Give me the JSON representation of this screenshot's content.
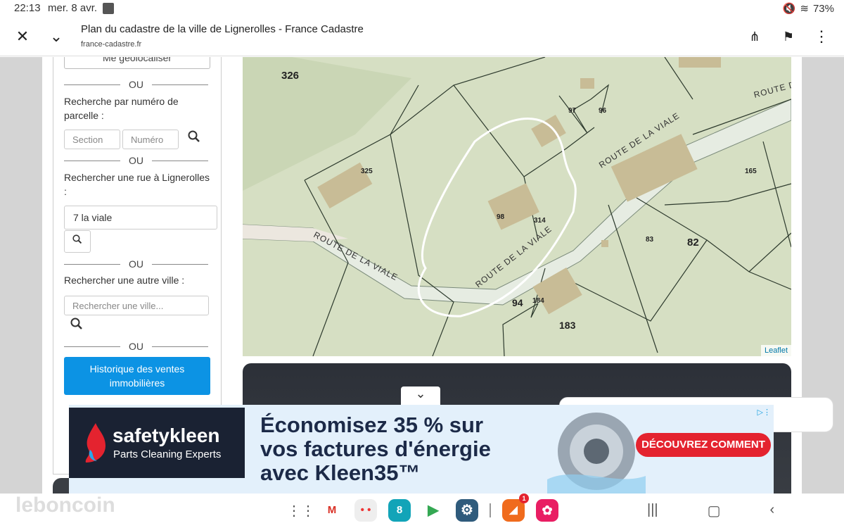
{
  "status": {
    "time": "22:13",
    "date": "mer. 8 avr.",
    "battery": "73%"
  },
  "toolbar": {
    "close_icon": "close-icon",
    "title": "Plan du cadastre de la ville de Lignerolles - France Cadastre",
    "url": "france-cadastre.fr"
  },
  "sidebar": {
    "geolocate_label": "Me géolocaliser",
    "or_label": "OU",
    "parcel_label": "Recherche par numéro de parcelle :",
    "section_placeholder": "Section",
    "number_placeholder": "Numéro",
    "street_label": "Rechercher une rue à Lignerolles :",
    "street_value": "7 la viale",
    "city_label": "Rechercher une autre ville :",
    "city_placeholder": "Rechercher une ville...",
    "history_button": "Historique des ventes immobilières"
  },
  "map": {
    "parcels": [
      "326",
      "97",
      "96",
      "325",
      "165",
      "98",
      "314",
      "83",
      "82",
      "94",
      "184",
      "183"
    ],
    "road_labels": [
      "ROUTE DE LA VIALE",
      "ROUTE DE LA VIALE",
      "ROUTE DE LA VIALE",
      "ROUTE D"
    ],
    "attribution": "Leaflet"
  },
  "ad": {
    "brand": "safetykleen",
    "brand_sub": "Parts Cleaning Experts",
    "headline_1": "Économisez 35 % sur",
    "headline_2": "vos factures d'énergie",
    "headline_3": "avec Kleen35™",
    "cta": "DÉCOUVREZ COMMENT"
  },
  "navbar": {
    "watermark": "leboncoin",
    "badge_count": "1",
    "calendar_day": "8"
  }
}
